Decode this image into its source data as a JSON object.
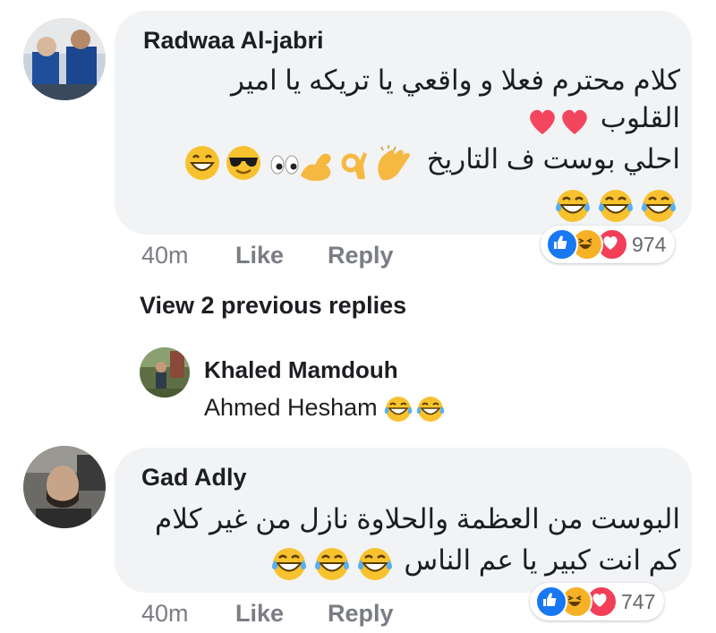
{
  "comments": [
    {
      "author": "Radwaa Al-jabri",
      "lines": [
        "كلام محترم فعلا و واقعي يا تريكه يا امير",
        "القلوب",
        "احلي بوست ف التاريخ"
      ],
      "time": "40m",
      "like_label": "Like",
      "reply_label": "Reply",
      "reaction_count": "974",
      "reaction_icons": [
        "like-reaction",
        "haha-reaction",
        "love-reaction"
      ]
    },
    {
      "author": "Gad Adly",
      "lines": [
        "البوست من العظمة والحلاوة نازل من غير كلام",
        "كم انت كبير يا عم الناس"
      ],
      "time": "40m",
      "like_label": "Like",
      "reply_label": "Reply",
      "reaction_count": "747",
      "reaction_icons": [
        "like-reaction",
        "haha-reaction",
        "love-reaction"
      ]
    }
  ],
  "view_previous": "View 2 previous replies",
  "reply": {
    "author": "Khaled Mamdouh",
    "text": "Ahmed Hesham"
  },
  "colors": {
    "bubble": "#f2f3f5",
    "like_blue": "#1877f2",
    "love_red": "#f33e58",
    "haha_yellow": "#f7b125",
    "meta_gray": "#7a7d83"
  }
}
